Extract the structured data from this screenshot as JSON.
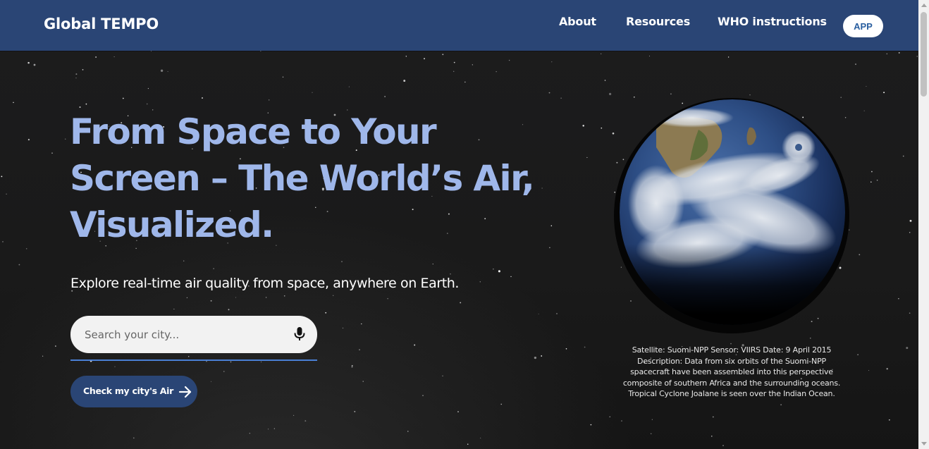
{
  "navbar": {
    "brand": "Global TEMPO",
    "links": [
      {
        "label": "About"
      },
      {
        "label": "Resources"
      },
      {
        "label": "WHO instructions"
      }
    ],
    "app_button": "APP",
    "background_color": "#2a4575"
  },
  "hero": {
    "title_lines": [
      "From Space to Your",
      "Screen – The World’s Air,",
      "Visualized."
    ],
    "subtitle": "Explore real-time air quality from space, anywhere on Earth.",
    "title_color": "#9fb7ea"
  },
  "search": {
    "placeholder": "Search your city...",
    "value": "",
    "mic_icon": "microphone-icon"
  },
  "cta": {
    "label": "Check my city's Air",
    "icon": "arrow-right-icon"
  },
  "globe": {
    "icon": "earth-globe-image",
    "caption_lines": [
      "Satellite: Suomi-NPP Sensor: VIIRS Date: 9 April 2015",
      "Description: Data from six orbits of the Suomi-NPP",
      "spacecraft have been assembled into this perspective",
      "composite of southern Africa and the surrounding oceans.",
      "Tropical Cyclone Joalane is seen over the Indian Ocean."
    ]
  },
  "colors": {
    "accent": "#4a7fd4",
    "background": "#1a1a1b"
  }
}
